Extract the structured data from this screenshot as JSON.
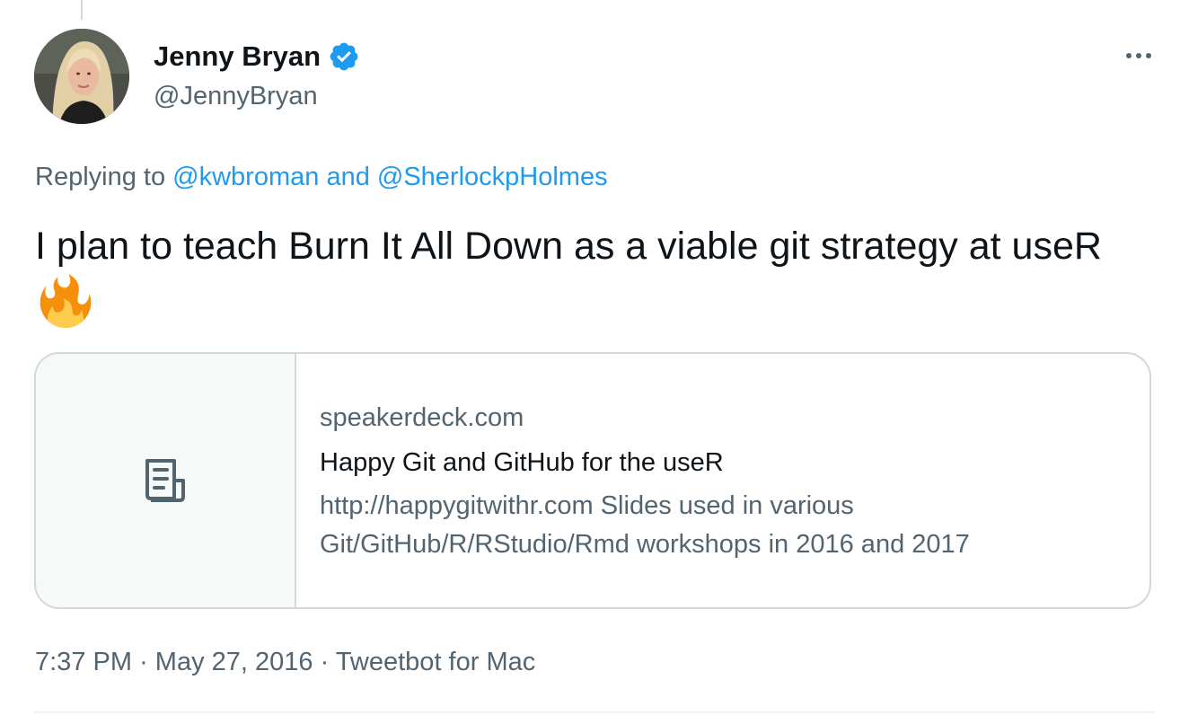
{
  "author": {
    "name": "Jenny Bryan",
    "handle": "@JennyBryan",
    "verified": true
  },
  "reply": {
    "prefix": "Replying to",
    "mention1": "@kwbroman",
    "connector": "and",
    "mention2": "@SherlockpHolmes"
  },
  "tweet": {
    "text": "I plan to teach Burn It All Down as a viable git strategy at useR",
    "emoji": "fire"
  },
  "link_card": {
    "icon": "document-icon",
    "domain": "speakerdeck.com",
    "title": "Happy Git and GitHub for the useR",
    "description": "http://happygitwithr.com Slides used in various Git/GitHub/R/RStudio/Rmd workshops in 2016 and 2017"
  },
  "meta": {
    "time": "7:37 PM",
    "separator": "·",
    "date": "May 27, 2016",
    "source": "Tweetbot for Mac"
  },
  "icons": {
    "more": "more-horizontal-icon",
    "verified": "verified-badge-icon"
  },
  "colors": {
    "accent": "#1d9bf0",
    "text": "#0f1419",
    "secondary": "#536471",
    "border": "#cfd9de",
    "fire_outer": "#f4900c",
    "fire_inner": "#ffcc4d"
  }
}
